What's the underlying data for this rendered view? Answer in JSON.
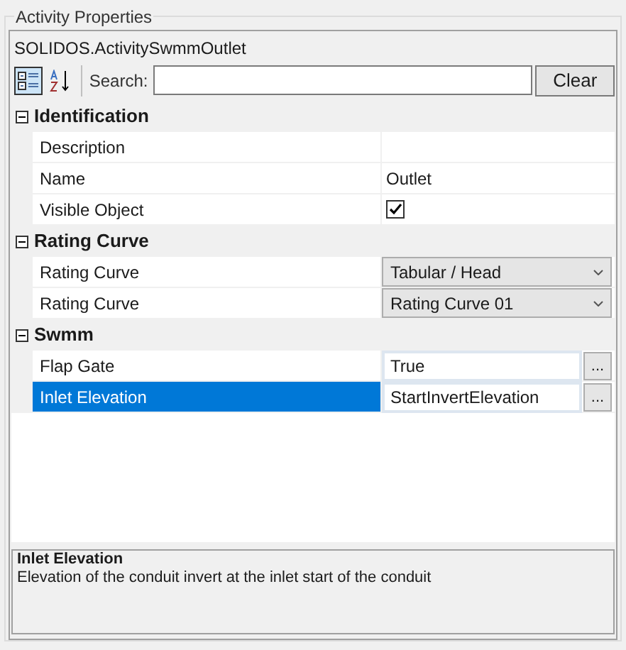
{
  "group_title": "Activity Properties",
  "object_name": "SOLIDOS.ActivitySwmmOutlet",
  "toolbar": {
    "categorized_selected": true,
    "alphabetical_selected": false,
    "search_label": "Search:",
    "clear_button": "Clear"
  },
  "categories": [
    {
      "name": "Identification",
      "expanded": true,
      "properties": [
        {
          "name": "Description",
          "kind": "text",
          "selected": false
        },
        {
          "name": "Name",
          "kind": "text",
          "value": "Outlet",
          "selected": false
        },
        {
          "name": "Visible Object",
          "kind": "checkbox",
          "checked": true,
          "selected": false
        }
      ]
    },
    {
      "name": "Rating Curve",
      "expanded": true,
      "properties": [
        {
          "name": "Rating Curve",
          "kind": "dropdown",
          "value": "Tabular / Head",
          "selected": false
        },
        {
          "name": "Rating Curve",
          "kind": "dropdown",
          "value": "Rating Curve 01",
          "selected": false
        }
      ]
    },
    {
      "name": "Swmm",
      "expanded": true,
      "properties": [
        {
          "name": "Flap Gate",
          "kind": "button",
          "value": "True",
          "button": "...",
          "selected": false
        },
        {
          "name": "Inlet Elevation",
          "kind": "button",
          "value": "StartInvertElevation",
          "button": "...",
          "selected": true
        }
      ]
    }
  ],
  "help": {
    "title": "Inlet Elevation",
    "description": "Elevation of the conduit invert at the inlet start of the conduit"
  }
}
